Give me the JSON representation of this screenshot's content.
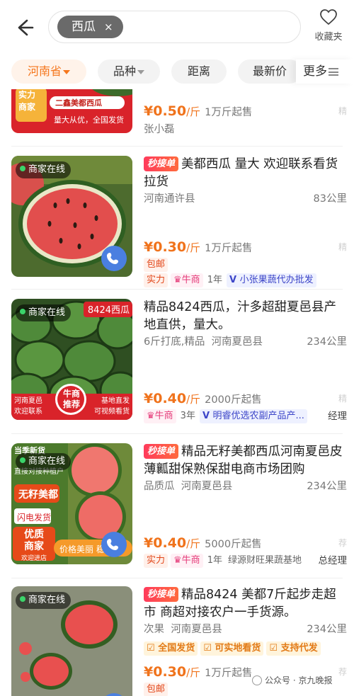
{
  "header": {
    "search_tag": "西瓜",
    "search_tag_clear": "×",
    "favorites_label": "收藏夹"
  },
  "filters": {
    "items": [
      {
        "label": "河南省",
        "active": true,
        "dropdown": true
      },
      {
        "label": "品种",
        "active": false,
        "dropdown": true
      },
      {
        "label": "距离",
        "active": false,
        "dropdown": false
      },
      {
        "label": "最新价",
        "active": false,
        "dropdown": false
      }
    ],
    "more_label": "更多"
  },
  "listings": [
    {
      "thumb_labels": [
        "实力",
        "商家",
        "二鑫美都西瓜",
        "量大从优，全国发货"
      ],
      "price": "¥0.50",
      "unit": "/斤",
      "min_order": "1万斤起售",
      "side_mark": "精",
      "seller": "张小磊"
    },
    {
      "online": "商家在线",
      "seckill": "秒接单",
      "title": "美都西瓜 量大 欢迎联系看货拉货",
      "location": "河南通许县",
      "distance": "83公里",
      "price": "¥0.30",
      "unit": "/斤",
      "min_order": "1万斤起售",
      "side_mark": "精",
      "extra_tag": "包邮",
      "tags": [
        {
          "text": "实力",
          "style": "t-red"
        },
        {
          "text": "牛商",
          "style": "t-pink"
        },
        {
          "text": "1年",
          "style": "t-plain"
        },
        {
          "text": "小张果蔬代办批发",
          "style": "t-blue"
        }
      ]
    },
    {
      "online": "商家在线",
      "corner_tag": "8424西瓜",
      "badge_lines": [
        "牛商",
        "推荐"
      ],
      "bottom_left": [
        "河南夏邑",
        "欢迎联系"
      ],
      "bottom_right": [
        "基地直发",
        "可视频看货"
      ],
      "title": "精品8424西瓜，汁多超甜夏邑县产地直供，量大。",
      "spec": "6斤打底,精品",
      "location": "河南夏邑县",
      "distance": "234公里",
      "price": "¥0.40",
      "unit": "/斤",
      "min_order": "2000斤起售",
      "side_mark": "精",
      "tags": [
        {
          "text": "牛商",
          "style": "t-pink"
        },
        {
          "text": "3年",
          "style": "t-plain"
        },
        {
          "text": "明睿优选农副产品产...",
          "style": "t-blue"
        }
      ],
      "right_label": "经理"
    },
    {
      "online": "商家在线",
      "thumb_labels": [
        "当季新货",
        "直接对接种植户",
        "无籽美都",
        "闪电发货",
        "优质",
        "商家",
        "欢迎进店",
        "价格美丽 稳"
      ],
      "seckill": "秒接单",
      "title": "精品无籽美都西瓜河南夏邑皮薄瓤甜保熟保甜电商市场团购",
      "spec": "品质瓜",
      "location": "河南夏邑县",
      "distance": "234公里",
      "price": "¥0.40",
      "unit": "/斤",
      "min_order": "5000斤起售",
      "side_mark": "荐",
      "tags": [
        {
          "text": "实力",
          "style": "t-red"
        },
        {
          "text": "牛商",
          "style": "t-pink"
        },
        {
          "text": "1年",
          "style": "t-plain"
        },
        {
          "text": "绿源财旺果蔬基地",
          "style": "t-plain"
        }
      ],
      "right_label": "总经理"
    },
    {
      "online": "商家在线",
      "seckill": "秒接单",
      "title": "精品8424 美都7斤起步走超市 商超对接农户一手货源。",
      "spec": "次果",
      "location": "河南夏邑县",
      "distance": "234公里",
      "service_tags": [
        "全国发货",
        "可实地看货",
        "支持代发"
      ],
      "price": "¥0.30",
      "unit": "/斤",
      "min_order": "1万斤起售",
      "side_mark": "荐",
      "extra_tag": "包邮"
    }
  ],
  "watermark": "公众号 · 京九晚报"
}
